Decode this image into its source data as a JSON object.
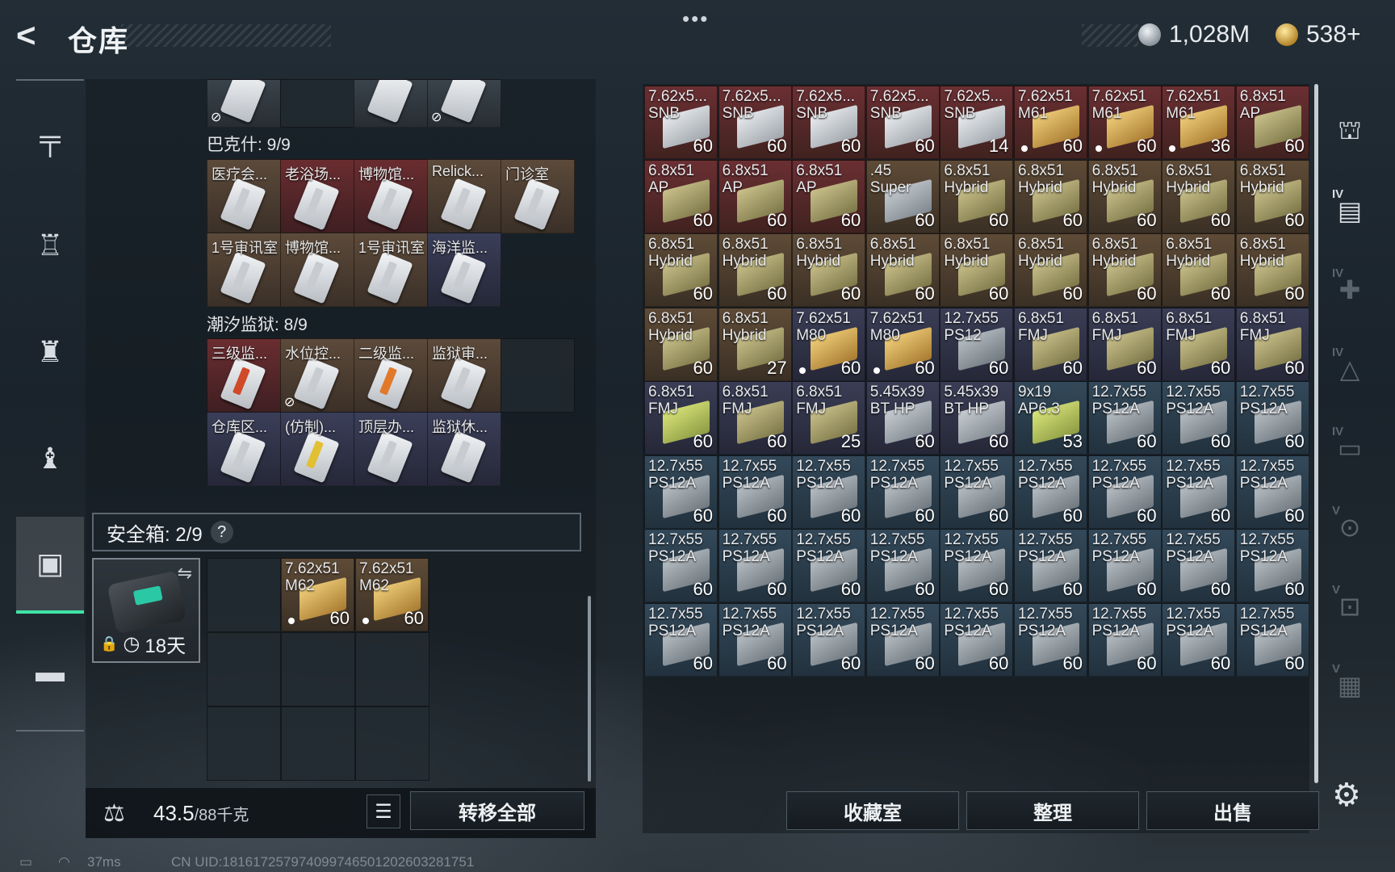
{
  "header": {
    "back_glyph": "<",
    "title": "仓库",
    "menu_dots": "•••",
    "currency": [
      {
        "name": "silver-coin-icon",
        "value": "1,028M"
      },
      {
        "name": "gold-coin-icon",
        "value": "538+"
      }
    ]
  },
  "sidebar": {
    "items": [
      {
        "key": "weapons",
        "icon": "gun-icon",
        "glyph": "╤"
      },
      {
        "key": "armor",
        "icon": "vest-icon",
        "glyph": "♖"
      },
      {
        "key": "backpack",
        "icon": "backpack-icon",
        "glyph": "♜"
      },
      {
        "key": "gear",
        "icon": "bag-icon",
        "glyph": "♝"
      },
      {
        "key": "safebox",
        "icon": "safebox-icon",
        "glyph": "▣",
        "active": true
      },
      {
        "key": "toolbox",
        "icon": "briefcase-icon",
        "glyph": "▬"
      }
    ]
  },
  "keycards": {
    "top_row": [
      {
        "name": "",
        "color": "gray",
        "nodrop": true
      },
      {
        "name": "",
        "color": "empty",
        "nodrop": false
      },
      {
        "name": "",
        "color": "gray",
        "nodrop": false
      },
      {
        "name": "",
        "color": "gray",
        "nodrop": true
      }
    ],
    "group1": {
      "label": "巴克什: 9/9",
      "row1": [
        {
          "name": "医疗会...",
          "color": "brown",
          "stripe": "#c8ccd0"
        },
        {
          "name": "老浴场...",
          "color": "red",
          "stripe": "#c8ccd0"
        },
        {
          "name": "博物馆...",
          "color": "red",
          "stripe": "#c8ccd0"
        },
        {
          "name": "Relick...",
          "color": "brown",
          "stripe": "#c8ccd0"
        },
        {
          "name": "门诊室",
          "color": "brown",
          "stripe": "#c8ccd0"
        }
      ],
      "row2": [
        {
          "name": "1号审讯室",
          "color": "brown",
          "stripe": "#c8ccd0"
        },
        {
          "name": "博物馆...",
          "color": "brown",
          "stripe": "#c8ccd0"
        },
        {
          "name": "1号审讯室",
          "color": "brown",
          "stripe": "#c8ccd0"
        },
        {
          "name": "海洋监...",
          "color": "blue",
          "stripe": "#c8ccd0"
        }
      ]
    },
    "group2": {
      "label": "潮汐监狱: 8/9",
      "row1": [
        {
          "name": "三级监...",
          "color": "red",
          "stripe": "#d04a2a",
          "nodrop": false
        },
        {
          "name": "水位控...",
          "color": "brown",
          "stripe": "#c8ccd0",
          "nodrop": true
        },
        {
          "name": "二级监...",
          "color": "brown",
          "stripe": "#e07a2a",
          "nodrop": false
        },
        {
          "name": "监狱审...",
          "color": "brown",
          "stripe": "#c8ccd0",
          "nodrop": false
        }
      ],
      "row2": [
        {
          "name": "仓库区...",
          "color": "blue",
          "stripe": "#c8ccd0"
        },
        {
          "name": "(仿制)...",
          "color": "blue",
          "stripe": "#e2c034"
        },
        {
          "name": "顶层办...",
          "color": "blue",
          "stripe": "#c8ccd0"
        },
        {
          "name": "监狱休...",
          "color": "blue",
          "stripe": "#c8ccd0"
        }
      ]
    }
  },
  "safebox": {
    "label": "安全箱: 2/9",
    "help": "?",
    "swap_glyph": "⇋",
    "lock_glyph": "🔒",
    "clock_glyph": "◷",
    "time_left": "18天",
    "items": [
      {
        "name": "7.62x51\nM62",
        "qty": "60",
        "color": "brown",
        "box": "gold",
        "dot": true
      },
      {
        "name": "7.62x51\nM62",
        "qty": "60",
        "color": "brown",
        "box": "gold",
        "dot": true
      }
    ]
  },
  "footer_left": {
    "kg_glyph": "⚖",
    "weight_current": "43.5",
    "weight_max": "/88千克",
    "list_glyph": "☰",
    "transfer_all": "转移全部"
  },
  "stash": [
    {
      "n": "7.62x5...\nSNB",
      "q": "60",
      "c": "red",
      "b": "white",
      "d": false
    },
    {
      "n": "7.62x5...\nSNB",
      "q": "60",
      "c": "red",
      "b": "white",
      "d": false
    },
    {
      "n": "7.62x5...\nSNB",
      "q": "60",
      "c": "red",
      "b": "white",
      "d": false
    },
    {
      "n": "7.62x5...\nSNB",
      "q": "60",
      "c": "red",
      "b": "white",
      "d": false
    },
    {
      "n": "7.62x5...\nSNB",
      "q": "14",
      "c": "red",
      "b": "white",
      "d": false
    },
    {
      "n": "7.62x51\nM61",
      "q": "60",
      "c": "red",
      "b": "gold",
      "d": true
    },
    {
      "n": "7.62x51\nM61",
      "q": "60",
      "c": "red",
      "b": "gold",
      "d": true
    },
    {
      "n": "7.62x51\nM61",
      "q": "36",
      "c": "red",
      "b": "gold",
      "d": true
    },
    {
      "n": "6.8x51\nAP",
      "q": "60",
      "c": "red",
      "b": "khaki",
      "d": false
    },
    {
      "n": "6.8x51\nAP",
      "q": "60",
      "c": "red",
      "b": "khaki",
      "d": false
    },
    {
      "n": "6.8x51\nAP",
      "q": "60",
      "c": "red",
      "b": "khaki",
      "d": false
    },
    {
      "n": "6.8x51\nAP",
      "q": "60",
      "c": "red",
      "b": "khaki",
      "d": false
    },
    {
      "n": ".45\nSuper",
      "q": "60",
      "c": "brown",
      "b": "silver",
      "d": false
    },
    {
      "n": "6.8x51\nHybrid",
      "q": "60",
      "c": "brown",
      "b": "khaki",
      "d": false
    },
    {
      "n": "6.8x51\nHybrid",
      "q": "60",
      "c": "brown",
      "b": "khaki",
      "d": false
    },
    {
      "n": "6.8x51\nHybrid",
      "q": "60",
      "c": "brown",
      "b": "khaki",
      "d": false
    },
    {
      "n": "6.8x51\nHybrid",
      "q": "60",
      "c": "brown",
      "b": "khaki",
      "d": false
    },
    {
      "n": "6.8x51\nHybrid",
      "q": "60",
      "c": "brown",
      "b": "khaki",
      "d": false
    },
    {
      "n": "6.8x51\nHybrid",
      "q": "60",
      "c": "brown",
      "b": "khaki",
      "d": false
    },
    {
      "n": "6.8x51\nHybrid",
      "q": "60",
      "c": "brown",
      "b": "khaki",
      "d": false
    },
    {
      "n": "6.8x51\nHybrid",
      "q": "60",
      "c": "brown",
      "b": "khaki",
      "d": false
    },
    {
      "n": "6.8x51\nHybrid",
      "q": "60",
      "c": "brown",
      "b": "khaki",
      "d": false
    },
    {
      "n": "6.8x51\nHybrid",
      "q": "60",
      "c": "brown",
      "b": "khaki",
      "d": false
    },
    {
      "n": "6.8x51\nHybrid",
      "q": "60",
      "c": "brown",
      "b": "khaki",
      "d": false
    },
    {
      "n": "6.8x51\nHybrid",
      "q": "60",
      "c": "brown",
      "b": "khaki",
      "d": false
    },
    {
      "n": "6.8x51\nHybrid",
      "q": "60",
      "c": "brown",
      "b": "khaki",
      "d": false
    },
    {
      "n": "6.8x51\nHybrid",
      "q": "60",
      "c": "brown",
      "b": "khaki",
      "d": false
    },
    {
      "n": "6.8x51\nHybrid",
      "q": "60",
      "c": "brown",
      "b": "khaki",
      "d": false
    },
    {
      "n": "6.8x51\nHybrid",
      "q": "27",
      "c": "brown",
      "b": "khaki",
      "d": false
    },
    {
      "n": "7.62x51\nM80",
      "q": "60",
      "c": "blue",
      "b": "gold",
      "d": true
    },
    {
      "n": "7.62x51\nM80",
      "q": "60",
      "c": "blue",
      "b": "gold",
      "d": true
    },
    {
      "n": "12.7x55\nPS12",
      "q": "60",
      "c": "blue",
      "b": "steel",
      "d": false
    },
    {
      "n": "6.8x51\nFMJ",
      "q": "60",
      "c": "blue",
      "b": "khaki",
      "d": false
    },
    {
      "n": "6.8x51\nFMJ",
      "q": "60",
      "c": "blue",
      "b": "khaki",
      "d": false
    },
    {
      "n": "6.8x51\nFMJ",
      "q": "60",
      "c": "blue",
      "b": "khaki",
      "d": false
    },
    {
      "n": "6.8x51\nFMJ",
      "q": "60",
      "c": "blue",
      "b": "khaki",
      "d": false
    },
    {
      "n": "6.8x51\nFMJ",
      "q": "60",
      "c": "blue",
      "b": "lime",
      "d": false
    },
    {
      "n": "6.8x51\nFMJ",
      "q": "60",
      "c": "blue",
      "b": "khaki",
      "d": false
    },
    {
      "n": "6.8x51\nFMJ",
      "q": "25",
      "c": "blue",
      "b": "khaki",
      "d": false
    },
    {
      "n": "5.45x39\nBT HP",
      "q": "60",
      "c": "blue",
      "b": "silver",
      "d": false
    },
    {
      "n": "5.45x39\nBT HP",
      "q": "60",
      "c": "blue",
      "b": "silver",
      "d": false
    },
    {
      "n": "9x19\nAP6.3",
      "q": "53",
      "c": "teal",
      "b": "lime",
      "d": false
    },
    {
      "n": "12.7x55\nPS12A",
      "q": "60",
      "c": "teal",
      "b": "steel",
      "d": false
    },
    {
      "n": "12.7x55\nPS12A",
      "q": "60",
      "c": "teal",
      "b": "steel",
      "d": false
    },
    {
      "n": "12.7x55\nPS12A",
      "q": "60",
      "c": "teal",
      "b": "steel",
      "d": false
    },
    {
      "n": "12.7x55\nPS12A",
      "q": "60",
      "c": "teal",
      "b": "steel",
      "d": false
    },
    {
      "n": "12.7x55\nPS12A",
      "q": "60",
      "c": "teal",
      "b": "steel",
      "d": false
    },
    {
      "n": "12.7x55\nPS12A",
      "q": "60",
      "c": "teal",
      "b": "steel",
      "d": false
    },
    {
      "n": "12.7x55\nPS12A",
      "q": "60",
      "c": "teal",
      "b": "steel",
      "d": false
    },
    {
      "n": "12.7x55\nPS12A",
      "q": "60",
      "c": "teal",
      "b": "steel",
      "d": false
    },
    {
      "n": "12.7x55\nPS12A",
      "q": "60",
      "c": "teal",
      "b": "steel",
      "d": false
    },
    {
      "n": "12.7x55\nPS12A",
      "q": "60",
      "c": "teal",
      "b": "steel",
      "d": false
    },
    {
      "n": "12.7x55\nPS12A",
      "q": "60",
      "c": "teal",
      "b": "steel",
      "d": false
    },
    {
      "n": "12.7x55\nPS12A",
      "q": "60",
      "c": "teal",
      "b": "steel",
      "d": false
    },
    {
      "n": "12.7x55\nPS12A",
      "q": "60",
      "c": "teal",
      "b": "steel",
      "d": false
    },
    {
      "n": "12.7x55\nPS12A",
      "q": "60",
      "c": "teal",
      "b": "steel",
      "d": false
    },
    {
      "n": "12.7x55\nPS12A",
      "q": "60",
      "c": "teal",
      "b": "steel",
      "d": false
    },
    {
      "n": "12.7x55\nPS12A",
      "q": "60",
      "c": "teal",
      "b": "steel",
      "d": false
    },
    {
      "n": "12.7x55\nPS12A",
      "q": "60",
      "c": "teal",
      "b": "steel",
      "d": false
    },
    {
      "n": "12.7x55\nPS12A",
      "q": "60",
      "c": "teal",
      "b": "steel",
      "d": false
    },
    {
      "n": "12.7x55\nPS12A",
      "q": "60",
      "c": "teal",
      "b": "steel",
      "d": false
    },
    {
      "n": "12.7x55\nPS12A",
      "q": "60",
      "c": "teal",
      "b": "steel",
      "d": false
    },
    {
      "n": "12.7x55\nPS12A",
      "q": "60",
      "c": "teal",
      "b": "steel",
      "d": false
    },
    {
      "n": "12.7x55\nPS12A",
      "q": "60",
      "c": "teal",
      "b": "steel",
      "d": false
    },
    {
      "n": "12.7x55\nPS12A",
      "q": "60",
      "c": "teal",
      "b": "steel",
      "d": false
    },
    {
      "n": "12.7x55\nPS12A",
      "q": "60",
      "c": "teal",
      "b": "steel",
      "d": false
    },
    {
      "n": "12.7x55\nPS12A",
      "q": "60",
      "c": "teal",
      "b": "steel",
      "d": false
    },
    {
      "n": "12.7x55\nPS12A",
      "q": "60",
      "c": "teal",
      "b": "steel",
      "d": false
    },
    {
      "n": "12.7x55\nPS12A",
      "q": "60",
      "c": "teal",
      "b": "steel",
      "d": false
    },
    {
      "n": "12.7x55\nPS12A",
      "q": "60",
      "c": "teal",
      "b": "steel",
      "d": false
    },
    {
      "n": "12.7x55\nPS12A",
      "q": "60",
      "c": "teal",
      "b": "steel",
      "d": false
    },
    {
      "n": "12.7x55\nPS12A",
      "q": "60",
      "c": "teal",
      "b": "steel",
      "d": false
    }
  ],
  "stash_tabs": [
    {
      "icon": "helmet-icon",
      "glyph": "⛫",
      "level": "",
      "dim": false
    },
    {
      "icon": "folder-icon",
      "glyph": "▤",
      "level": "IV",
      "dim": false
    },
    {
      "icon": "medkit-icon",
      "glyph": "✚",
      "level": "IV",
      "dim": true
    },
    {
      "icon": "triangle-box-icon",
      "glyph": "△",
      "level": "IV",
      "dim": true
    },
    {
      "icon": "rifle-case-icon",
      "glyph": "▭",
      "level": "IV",
      "dim": true
    },
    {
      "icon": "key-box-icon",
      "glyph": "⊙",
      "level": "V",
      "dim": true
    },
    {
      "icon": "card-box-icon",
      "glyph": "⊡",
      "level": "V",
      "dim": true
    },
    {
      "icon": "crate-icon",
      "glyph": "▦",
      "level": "V",
      "dim": true
    }
  ],
  "actions": {
    "collection": "收藏室",
    "sort": "整理",
    "sell": "出售",
    "settings_glyph": "⚙"
  },
  "status": {
    "battery_glyph": "▭",
    "wifi_glyph": "◠",
    "ping": "37ms",
    "uid": "CN UID:1816172579740997465012026032817​51"
  }
}
